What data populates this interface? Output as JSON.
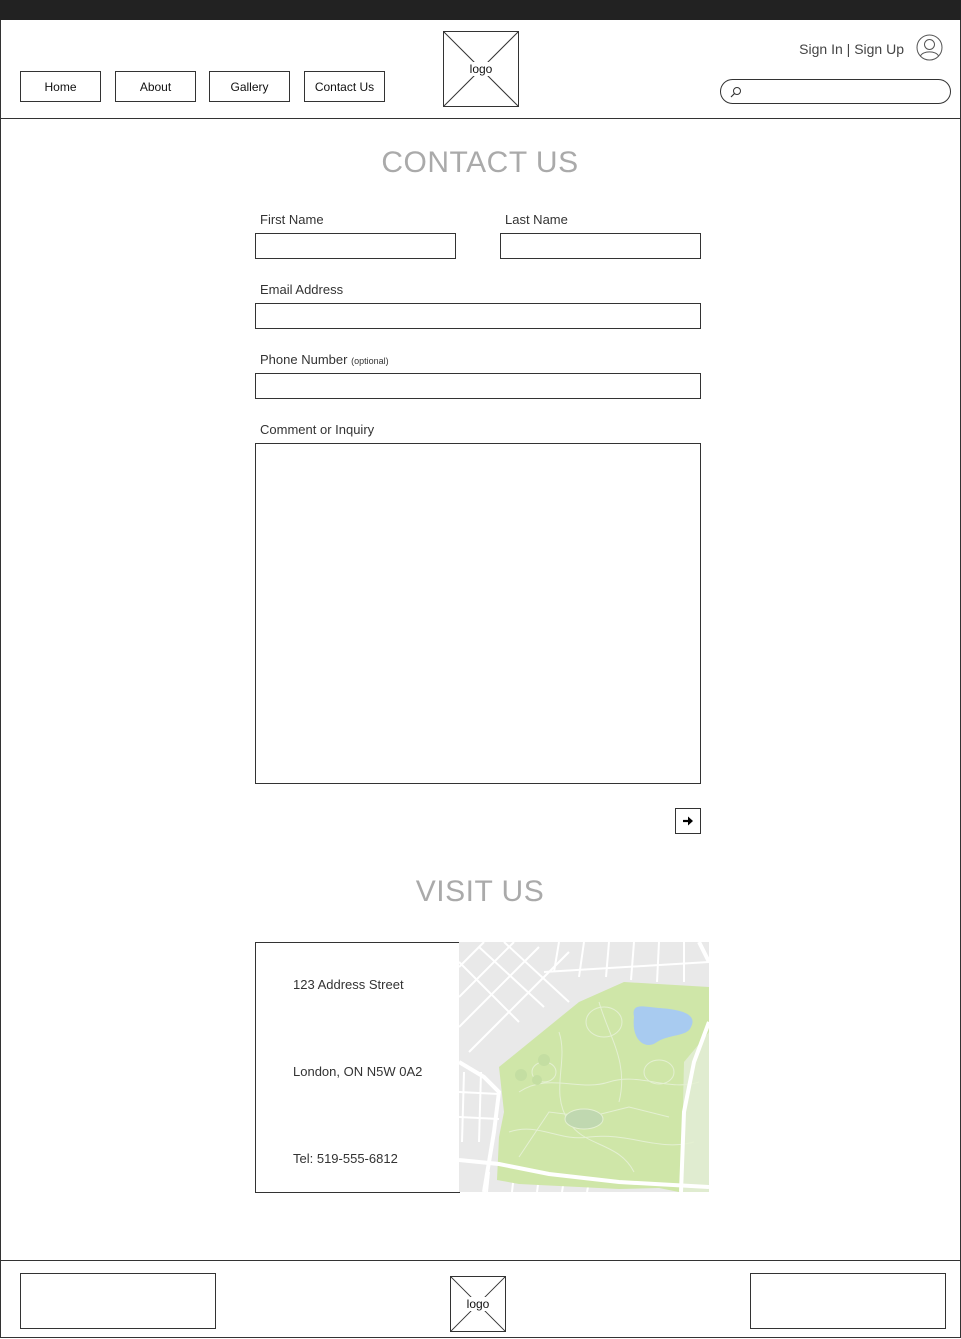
{
  "header": {
    "nav": [
      "Home",
      "About",
      "Gallery",
      "Contact Us"
    ],
    "logo_label": "logo",
    "sign_in": "Sign In",
    "separator": " | ",
    "sign_up": "Sign Up",
    "search_placeholder": ""
  },
  "contact": {
    "title": "CONTACT US",
    "first_name_label": "First Name",
    "last_name_label": "Last Name",
    "email_label": "Email Address",
    "phone_label": "Phone Number",
    "phone_note": "(optional)",
    "comment_label": "Comment or Inquiry",
    "submit_icon": "arrow-right-icon"
  },
  "visit": {
    "title": "VISIT US",
    "address_line1": "123 Address Street",
    "address_line2": "London, ON N5W 0A2",
    "phone": "Tel: 519-555-6812"
  },
  "footer": {
    "logo_label": "logo"
  },
  "colors": {
    "top_bar": "#222222",
    "title_gray": "#aaaaaa",
    "map_park": "#cfe6a8",
    "map_water": "#a8cbf0",
    "map_streets": "#e6e6e6"
  }
}
